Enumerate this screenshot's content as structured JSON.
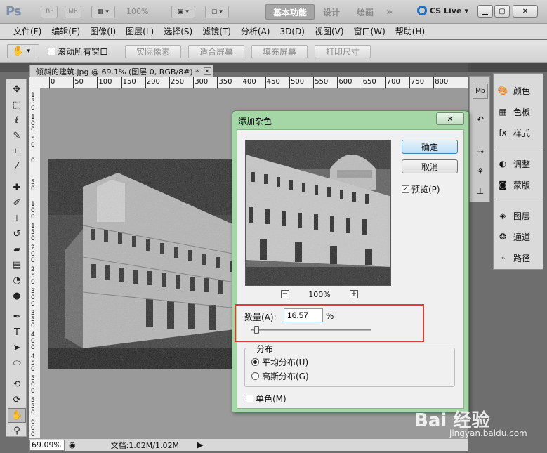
{
  "appbar": {
    "logo": "Ps",
    "br_label": "Br",
    "mb_label": "Mb",
    "zoom_value": "100%",
    "workspaces": [
      "基本功能",
      "设计",
      "绘画"
    ],
    "more": "»",
    "cs_live": "CS Live"
  },
  "menubar": {
    "items": [
      "文件(F)",
      "编辑(E)",
      "图像(I)",
      "图层(L)",
      "选择(S)",
      "滤镜(T)",
      "分析(A)",
      "3D(D)",
      "视图(V)",
      "窗口(W)",
      "帮助(H)"
    ]
  },
  "options": {
    "scroll_all": "滚动所有窗口",
    "buttons": [
      "实际像素",
      "适合屏幕",
      "填充屏幕",
      "打印尺寸"
    ]
  },
  "document": {
    "tab_title": "倾斜的建筑.jpg @ 69.1% (图层 0, RGB/8#) *",
    "ruler_labels": [
      "0",
      "50",
      "100",
      "150",
      "200",
      "250",
      "300",
      "350",
      "400",
      "450",
      "500",
      "550",
      "600",
      "650",
      "700",
      "750",
      "800"
    ],
    "vruler_labels": [
      "150",
      "100",
      "50",
      "0",
      "50",
      "100",
      "150",
      "200",
      "250",
      "300",
      "350",
      "400",
      "450",
      "500",
      "550",
      "600"
    ]
  },
  "status": {
    "zoom": "69.09%",
    "doc_info": "文档:1.02M/1.02M"
  },
  "panels": {
    "items": [
      {
        "label": "颜色",
        "icon": "color-icon"
      },
      {
        "label": "色板",
        "icon": "swatches-icon"
      },
      {
        "label": "样式",
        "icon": "styles-icon"
      },
      {
        "label": "调整",
        "icon": "adjustments-icon"
      },
      {
        "label": "蒙版",
        "icon": "masks-icon"
      },
      {
        "label": "图层",
        "icon": "layers-icon"
      },
      {
        "label": "通道",
        "icon": "channels-icon"
      },
      {
        "label": "路径",
        "icon": "paths-icon"
      }
    ],
    "dock_mb": "Mb"
  },
  "dialog": {
    "title": "添加杂色",
    "ok": "确定",
    "cancel": "取消",
    "preview": "预览(P)",
    "zoom": "100%",
    "amount_label": "数量(A):",
    "amount_value": "16.57",
    "amount_unit": "%",
    "amount_fraction": 0.04,
    "distribution_title": "分布",
    "uniform": "平均分布(U)",
    "gaussian": "高斯分布(G)",
    "monochromatic": "单色(M)"
  },
  "watermark": {
    "main": "Bai 经验",
    "sub": "jingyan.baidu.com"
  },
  "colors": {
    "dialog_frame": "#a4d6a6",
    "highlight": "#e03a3a",
    "primary_button": "#bfe0f6"
  }
}
